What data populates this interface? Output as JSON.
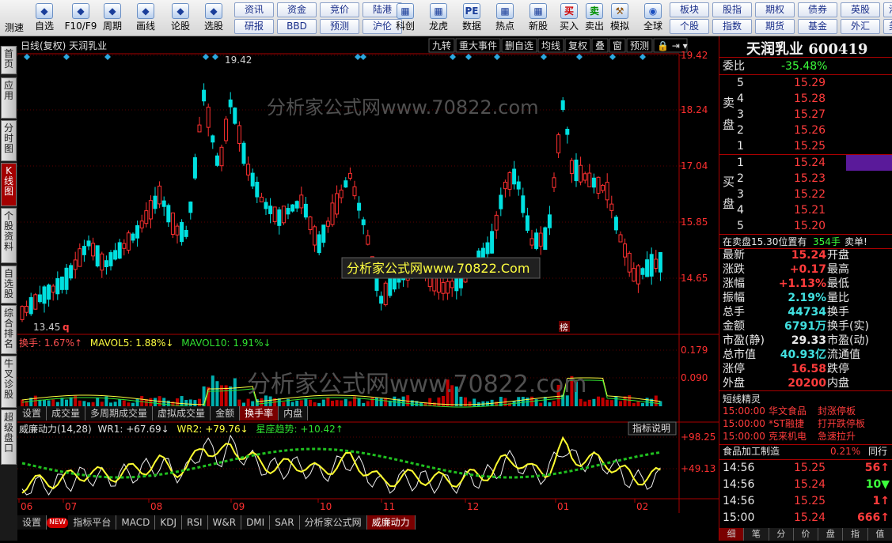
{
  "toolbar": {
    "left_buttons": [
      {
        "label": "测速",
        "icon": "speed-icon"
      },
      {
        "label": "自选",
        "icon": "star-icon"
      },
      {
        "label": "F10/F9",
        "icon": "f10-icon"
      },
      {
        "label": "周期",
        "icon": "clock-icon"
      },
      {
        "label": "画线",
        "icon": "pen-icon"
      },
      {
        "label": "论股",
        "icon": "forum-icon"
      },
      {
        "label": "选股",
        "icon": "stock-pick-icon"
      }
    ],
    "grid_buttons": [
      [
        "资讯",
        "资金",
        "竞价",
        "陆港"
      ],
      [
        "研报",
        "BBD",
        "预测",
        "沪伦"
      ]
    ],
    "mid_buttons": [
      {
        "label": "科创",
        "icon": "chart-icon"
      },
      {
        "label": "龙虎",
        "icon": "dragon-icon"
      },
      {
        "label": "数据",
        "icon": "pe-icon"
      },
      {
        "label": "热点",
        "icon": "hot-icon"
      },
      {
        "label": "新股",
        "icon": "ipo-icon"
      }
    ],
    "trade_buttons": [
      {
        "label": "买入",
        "glyph": "买"
      },
      {
        "label": "卖出",
        "glyph": "卖"
      },
      {
        "label": "模拟",
        "glyph": "⚒"
      },
      {
        "label": "全球",
        "glyph": "◉"
      }
    ],
    "right_grid": [
      [
        "板块",
        "股指",
        "期权",
        "债券",
        "英股",
        "港"
      ],
      [
        "个股",
        "指数",
        "期货",
        "基金",
        "外汇",
        "美"
      ]
    ]
  },
  "sidebar": [
    "首页",
    "应用",
    "分时图",
    "K线图",
    "个股资料",
    "自选股",
    "综合排名",
    "牛叉诊股",
    "超级盘口"
  ],
  "chart": {
    "header_left": "日线(复权)  天润乳业",
    "header_tabs": [
      "九转",
      "重大事件",
      "删自选",
      "均线",
      "复权",
      "叠",
      "窗",
      "预测"
    ],
    "watermark1": "分析家公式网www.70822.com",
    "watermark_box": "分析家公式网www.70822.Com",
    "watermark2": "分析家公式网www.70822.com",
    "price_axis": [
      "19.42",
      "18.24",
      "17.04",
      "15.85",
      "14.65"
    ],
    "high_label": "19.42",
    "low_label": "13.45",
    "q_mark": "q",
    "bang_mark": "榜",
    "vol_legend": {
      "a": "换手: 1.67%↑",
      "b": "MAVOL5: 1.88%↓",
      "c": "MAVOL10: 1.91%↓"
    },
    "vol_axis": [
      "0.179",
      "0.090"
    ],
    "vol_tabs": [
      "设置",
      "成交量",
      "多周期成交量",
      "虚拟成交量",
      "金额",
      "换手率",
      "内盘"
    ],
    "vol_tab_active": "换手率",
    "ind_legend": {
      "a": "威廉动力(14,28)",
      "b": "WR1: +67.69↓",
      "c": "WR2: +79.76↓",
      "d": "星座趋势: +10.42↑"
    },
    "ind_btn": "指标说明",
    "ind_axis": [
      "+98.25",
      "+49.13"
    ],
    "months": [
      "06",
      "07",
      "08",
      "09",
      "10",
      "11",
      "12",
      "01",
      "02"
    ],
    "ind_tabs": [
      "设置",
      "NEW",
      "指标平台",
      "MACD",
      "KDJ",
      "RSI",
      "W&R",
      "DMI",
      "SAR",
      "分析家公式网",
      "威廉动力"
    ],
    "ind_tab_active": "威廉动力"
  },
  "quote": {
    "title": "天润乳业 600419",
    "weibi_label": "委比",
    "weibi": "-35.48%",
    "sell_label": "卖盘",
    "buy_label": "买盘",
    "sell": [
      [
        "5",
        "15.29"
      ],
      [
        "4",
        "15.28"
      ],
      [
        "3",
        "15.27"
      ],
      [
        "2",
        "15.26"
      ],
      [
        "1",
        "15.25"
      ]
    ],
    "buy": [
      [
        "1",
        "15.24"
      ],
      [
        "2",
        "15.23"
      ],
      [
        "3",
        "15.22"
      ],
      [
        "4",
        "15.21"
      ],
      [
        "5",
        "15.20"
      ]
    ],
    "notice": "在卖盘15.30位置有",
    "notice_val": "354手",
    "notice_tail": "卖单!",
    "stats": [
      [
        "最新",
        "15.24",
        "开盘"
      ],
      [
        "涨跌",
        "+0.17",
        "最高"
      ],
      [
        "涨幅",
        "+1.13%",
        "最低"
      ],
      [
        "振幅",
        "2.19%",
        "量比"
      ],
      [
        "总手",
        "44734",
        "换手"
      ],
      [
        "金额",
        "6791万",
        "换手(实)"
      ],
      [
        "市盈(静)",
        "29.33",
        "市盈(动)"
      ],
      [
        "总市值",
        "40.93亿",
        "流通值"
      ],
      [
        "涨停",
        "16.58",
        "跌停"
      ],
      [
        "外盘",
        "20200",
        "内盘"
      ]
    ],
    "short_title": "短线精灵",
    "short": [
      [
        "15:00:00",
        "华文食品",
        "封涨停板"
      ],
      [
        "15:00:00",
        "*ST融捷",
        "打开跌停板"
      ],
      [
        "15:00:00",
        "克来机电",
        "急速拉升"
      ]
    ],
    "sector": [
      "食品加工制造",
      "0.21%",
      "同行"
    ],
    "ticks": [
      [
        "14:56",
        "15.25",
        "56↑"
      ],
      [
        "14:56",
        "15.24",
        "10▼"
      ],
      [
        "14:56",
        "15.25",
        "1↑"
      ],
      [
        "15:00",
        "15.24",
        "666↑"
      ]
    ],
    "bottom_tabs": [
      "细",
      "笔",
      "分",
      "价",
      "盘",
      "指",
      "值"
    ]
  }
}
